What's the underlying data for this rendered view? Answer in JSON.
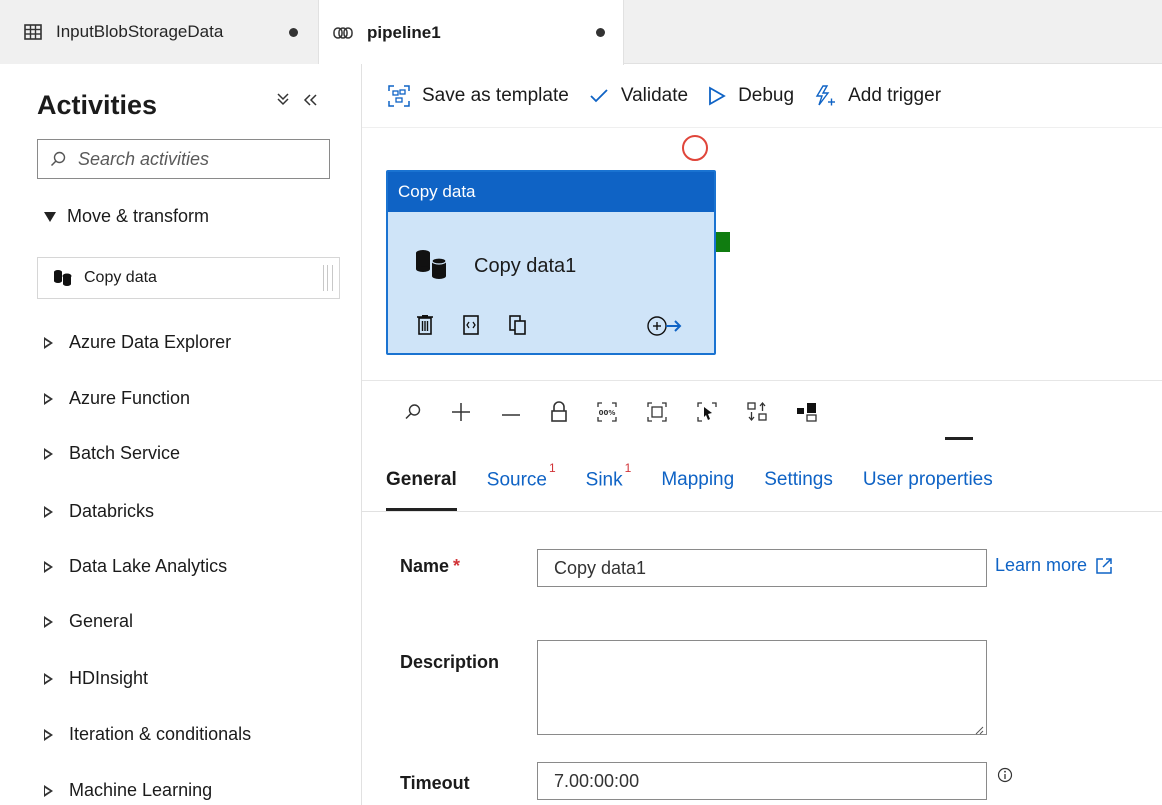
{
  "tabs": [
    {
      "label": "InputBlobStorageData",
      "icon": "table-icon",
      "unsaved": true
    },
    {
      "label": "pipeline1",
      "icon": "pipeline-icon",
      "unsaved": true
    }
  ],
  "sidebar": {
    "title": "Activities",
    "search_placeholder": "Search activities",
    "open_group": "Move & transform",
    "open_group_item": "Copy data",
    "groups": [
      "Azure Data Explorer",
      "Azure Function",
      "Batch Service",
      "Databricks",
      "Data Lake Analytics",
      "General",
      "HDInsight",
      "Iteration & conditionals",
      "Machine Learning"
    ]
  },
  "toolbar": {
    "save_template": "Save as template",
    "validate": "Validate",
    "debug": "Debug",
    "add_trigger": "Add trigger"
  },
  "canvas": {
    "node_header": "Copy data",
    "node_name": "Copy data1"
  },
  "detail_tabs": [
    {
      "label": "General",
      "badge": ""
    },
    {
      "label": "Source",
      "badge": "1"
    },
    {
      "label": "Sink",
      "badge": "1"
    },
    {
      "label": "Mapping",
      "badge": ""
    },
    {
      "label": "Settings",
      "badge": ""
    },
    {
      "label": "User properties",
      "badge": ""
    }
  ],
  "form": {
    "name_label": "Name",
    "required_marker": "*",
    "name_value": "Copy data1",
    "learn_more": "Learn more",
    "description_label": "Description",
    "description_value": "",
    "timeout_label": "Timeout",
    "timeout_value": "7.00:00:00"
  },
  "colors": {
    "accent": "#0f63c5",
    "node_fill": "#cfe4f8",
    "error": "#e0453a",
    "success_port": "#107c10"
  }
}
